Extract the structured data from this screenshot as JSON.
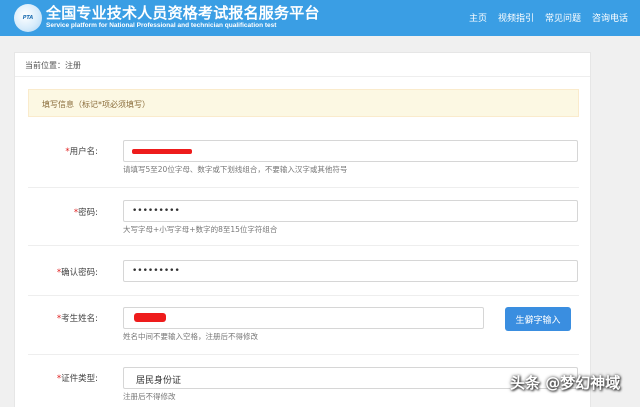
{
  "header": {
    "logo_text": "PTA",
    "title_cn": "全国专业技术人员资格考试报名服务平台",
    "title_en": "Service platform for National Professional and technician qualification test",
    "nav": [
      "主页",
      "视频指引",
      "常见问题",
      "咨询电话"
    ]
  },
  "breadcrumb": "当前位置：注册",
  "notice": "填写信息（标记*项必须填写）",
  "form": {
    "username": {
      "required": "*",
      "label": "用户名:",
      "hint": "请填写5至20位字母、数字或下划线组合，不要输入汉字或其他符号"
    },
    "password": {
      "required": "*",
      "label": "密码:",
      "value": "•••••••••",
      "hint": "大写字母+小写字母+数字的8至15位字符组合"
    },
    "confirm_password": {
      "required": "*",
      "label": "确认密码:",
      "value": "•••••••••"
    },
    "name": {
      "required": "*",
      "label": "考生姓名:",
      "hint": "姓名中间不要输入空格，注册后不得修改",
      "button": "生僻字输入"
    },
    "id_type": {
      "required": "*",
      "label": "证件类型:",
      "value": "居民身份证",
      "hint": "注册后不得修改"
    }
  },
  "watermark": "头条 @梦幻神域",
  "colors": {
    "header": "#3a9ee4",
    "notice_bg": "#fcf8e3",
    "notice_text": "#8a6d3b",
    "button": "#3a8ee0",
    "redaction": "#ee1c1c"
  }
}
